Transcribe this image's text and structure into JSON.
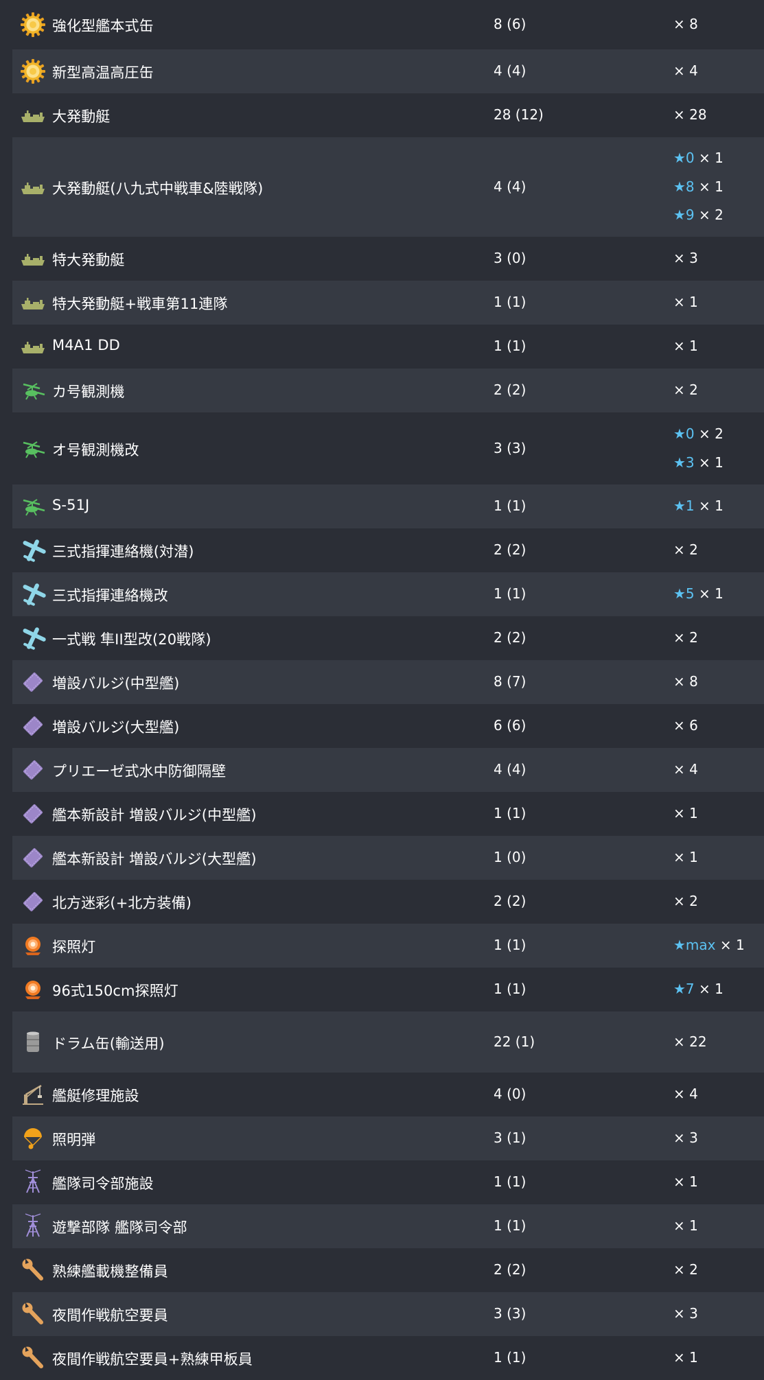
{
  "colors": {
    "row_odd": "#2b2e36",
    "row_even": "#363a43",
    "text": "#ffffff",
    "star": "#5cc2f2"
  },
  "equipment": [
    {
      "icon": "boiler-icon",
      "name": "強化型艦本式缶",
      "count": "8 (6)",
      "quantities": [
        {
          "star": "",
          "qty": "× 8"
        }
      ]
    },
    {
      "icon": "boiler-icon",
      "name": "新型高温高圧缶",
      "count": "4 (4)",
      "quantities": [
        {
          "star": "",
          "qty": "× 4"
        }
      ]
    },
    {
      "icon": "landing-craft-icon",
      "name": "大発動艇",
      "count": "28 (12)",
      "quantities": [
        {
          "star": "",
          "qty": "× 28"
        }
      ]
    },
    {
      "icon": "landing-craft-icon",
      "name": "大発動艇(八九式中戦車&陸戦隊)",
      "count": "4 (4)",
      "quantities": [
        {
          "star": "★0",
          "qty": "× 1"
        },
        {
          "star": "★8",
          "qty": "× 1"
        },
        {
          "star": "★9",
          "qty": "× 2"
        }
      ]
    },
    {
      "icon": "landing-craft-icon",
      "name": "特大発動艇",
      "count": "3 (0)",
      "quantities": [
        {
          "star": "",
          "qty": "× 3"
        }
      ]
    },
    {
      "icon": "landing-craft-icon",
      "name": "特大発動艇+戦車第11連隊",
      "count": "1 (1)",
      "quantities": [
        {
          "star": "",
          "qty": "× 1"
        }
      ]
    },
    {
      "icon": "landing-craft-icon",
      "name": "M4A1 DD",
      "count": "1 (1)",
      "quantities": [
        {
          "star": "",
          "qty": "× 1"
        }
      ]
    },
    {
      "icon": "autogyro-icon",
      "name": "カ号観測機",
      "count": "2 (2)",
      "quantities": [
        {
          "star": "",
          "qty": "× 2"
        }
      ]
    },
    {
      "icon": "autogyro-icon",
      "name": "オ号観測機改",
      "count": "3 (3)",
      "quantities": [
        {
          "star": "★0",
          "qty": "× 2"
        },
        {
          "star": "★3",
          "qty": "× 1"
        }
      ]
    },
    {
      "icon": "autogyro-icon",
      "name": "S-51J",
      "count": "1 (1)",
      "quantities": [
        {
          "star": "★1",
          "qty": "× 1"
        }
      ]
    },
    {
      "icon": "liaison-aircraft-icon",
      "name": "三式指揮連絡機(対潜)",
      "count": "2 (2)",
      "quantities": [
        {
          "star": "",
          "qty": "× 2"
        }
      ]
    },
    {
      "icon": "liaison-aircraft-icon",
      "name": "三式指揮連絡機改",
      "count": "1 (1)",
      "quantities": [
        {
          "star": "★5",
          "qty": "× 1"
        }
      ]
    },
    {
      "icon": "liaison-aircraft-icon",
      "name": "一式戦 隼II型改(20戦隊)",
      "count": "2 (2)",
      "quantities": [
        {
          "star": "",
          "qty": "× 2"
        }
      ]
    },
    {
      "icon": "bulge-icon",
      "name": "増設バルジ(中型艦)",
      "count": "8 (7)",
      "quantities": [
        {
          "star": "",
          "qty": "× 8"
        }
      ]
    },
    {
      "icon": "bulge-icon",
      "name": "増設バルジ(大型艦)",
      "count": "6 (6)",
      "quantities": [
        {
          "star": "",
          "qty": "× 6"
        }
      ]
    },
    {
      "icon": "bulge-icon",
      "name": "プリエーゼ式水中防御隔壁",
      "count": "4 (4)",
      "quantities": [
        {
          "star": "",
          "qty": "× 4"
        }
      ]
    },
    {
      "icon": "bulge-icon",
      "name": "艦本新設計 増設バルジ(中型艦)",
      "count": "1 (1)",
      "quantities": [
        {
          "star": "",
          "qty": "× 1"
        }
      ]
    },
    {
      "icon": "bulge-icon",
      "name": "艦本新設計 増設バルジ(大型艦)",
      "count": "1 (0)",
      "quantities": [
        {
          "star": "",
          "qty": "× 1"
        }
      ]
    },
    {
      "icon": "bulge-icon",
      "name": "北方迷彩(+北方装備)",
      "count": "2 (2)",
      "quantities": [
        {
          "star": "",
          "qty": "× 2"
        }
      ]
    },
    {
      "icon": "searchlight-icon",
      "name": "探照灯",
      "count": "1 (1)",
      "quantities": [
        {
          "star": "★max",
          "qty": "× 1"
        }
      ]
    },
    {
      "icon": "searchlight-icon",
      "name": "96式150cm探照灯",
      "count": "1 (1)",
      "quantities": [
        {
          "star": "★7",
          "qty": "× 1"
        }
      ]
    },
    {
      "icon": "drum-canister-icon",
      "name": "ドラム缶(輸送用)",
      "count": "22 (1)",
      "quantities": [
        {
          "star": "",
          "qty": "× 22"
        }
      ]
    },
    {
      "icon": "repair-facility-icon",
      "name": "艦艇修理施設",
      "count": "4 (0)",
      "quantities": [
        {
          "star": "",
          "qty": "× 4"
        }
      ]
    },
    {
      "icon": "star-shell-icon",
      "name": "照明弾",
      "count": "3 (1)",
      "quantities": [
        {
          "star": "",
          "qty": "× 3"
        }
      ]
    },
    {
      "icon": "command-facility-icon",
      "name": "艦隊司令部施設",
      "count": "1 (1)",
      "quantities": [
        {
          "star": "",
          "qty": "× 1"
        }
      ]
    },
    {
      "icon": "command-facility-icon",
      "name": "遊撃部隊 艦隊司令部",
      "count": "1 (1)",
      "quantities": [
        {
          "star": "",
          "qty": "× 1"
        }
      ]
    },
    {
      "icon": "wrench-icon",
      "name": "熟練艦載機整備員",
      "count": "2 (2)",
      "quantities": [
        {
          "star": "",
          "qty": "× 2"
        }
      ]
    },
    {
      "icon": "wrench-icon",
      "name": "夜間作戦航空要員",
      "count": "3 (3)",
      "quantities": [
        {
          "star": "",
          "qty": "× 3"
        }
      ]
    },
    {
      "icon": "wrench-icon",
      "name": "夜間作戦航空要員+熟練甲板員",
      "count": "1 (1)",
      "quantities": [
        {
          "star": "",
          "qty": "× 1"
        }
      ]
    }
  ]
}
